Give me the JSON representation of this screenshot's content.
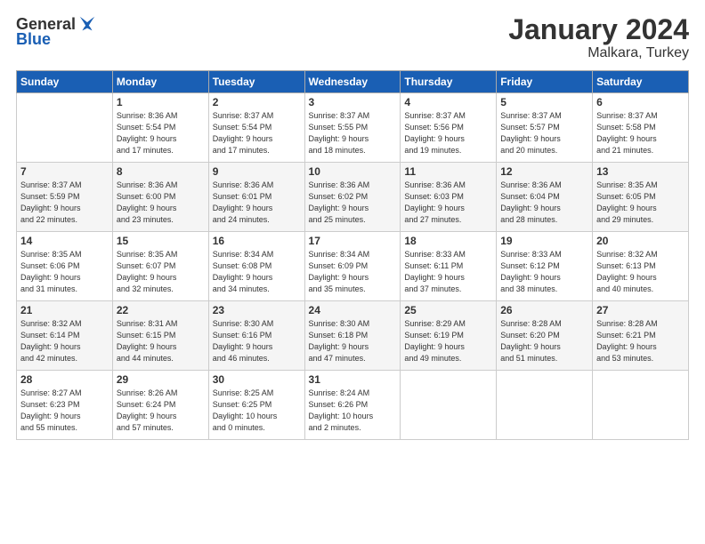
{
  "header": {
    "logo_general": "General",
    "logo_blue": "Blue",
    "month": "January 2024",
    "location": "Malkara, Turkey"
  },
  "weekdays": [
    "Sunday",
    "Monday",
    "Tuesday",
    "Wednesday",
    "Thursday",
    "Friday",
    "Saturday"
  ],
  "weeks": [
    [
      {
        "day": "",
        "content": ""
      },
      {
        "day": "1",
        "content": "Sunrise: 8:36 AM\nSunset: 5:54 PM\nDaylight: 9 hours\nand 17 minutes."
      },
      {
        "day": "2",
        "content": "Sunrise: 8:37 AM\nSunset: 5:54 PM\nDaylight: 9 hours\nand 17 minutes."
      },
      {
        "day": "3",
        "content": "Sunrise: 8:37 AM\nSunset: 5:55 PM\nDaylight: 9 hours\nand 18 minutes."
      },
      {
        "day": "4",
        "content": "Sunrise: 8:37 AM\nSunset: 5:56 PM\nDaylight: 9 hours\nand 19 minutes."
      },
      {
        "day": "5",
        "content": "Sunrise: 8:37 AM\nSunset: 5:57 PM\nDaylight: 9 hours\nand 20 minutes."
      },
      {
        "day": "6",
        "content": "Sunrise: 8:37 AM\nSunset: 5:58 PM\nDaylight: 9 hours\nand 21 minutes."
      }
    ],
    [
      {
        "day": "7",
        "content": "Sunrise: 8:37 AM\nSunset: 5:59 PM\nDaylight: 9 hours\nand 22 minutes."
      },
      {
        "day": "8",
        "content": "Sunrise: 8:36 AM\nSunset: 6:00 PM\nDaylight: 9 hours\nand 23 minutes."
      },
      {
        "day": "9",
        "content": "Sunrise: 8:36 AM\nSunset: 6:01 PM\nDaylight: 9 hours\nand 24 minutes."
      },
      {
        "day": "10",
        "content": "Sunrise: 8:36 AM\nSunset: 6:02 PM\nDaylight: 9 hours\nand 25 minutes."
      },
      {
        "day": "11",
        "content": "Sunrise: 8:36 AM\nSunset: 6:03 PM\nDaylight: 9 hours\nand 27 minutes."
      },
      {
        "day": "12",
        "content": "Sunrise: 8:36 AM\nSunset: 6:04 PM\nDaylight: 9 hours\nand 28 minutes."
      },
      {
        "day": "13",
        "content": "Sunrise: 8:35 AM\nSunset: 6:05 PM\nDaylight: 9 hours\nand 29 minutes."
      }
    ],
    [
      {
        "day": "14",
        "content": "Sunrise: 8:35 AM\nSunset: 6:06 PM\nDaylight: 9 hours\nand 31 minutes."
      },
      {
        "day": "15",
        "content": "Sunrise: 8:35 AM\nSunset: 6:07 PM\nDaylight: 9 hours\nand 32 minutes."
      },
      {
        "day": "16",
        "content": "Sunrise: 8:34 AM\nSunset: 6:08 PM\nDaylight: 9 hours\nand 34 minutes."
      },
      {
        "day": "17",
        "content": "Sunrise: 8:34 AM\nSunset: 6:09 PM\nDaylight: 9 hours\nand 35 minutes."
      },
      {
        "day": "18",
        "content": "Sunrise: 8:33 AM\nSunset: 6:11 PM\nDaylight: 9 hours\nand 37 minutes."
      },
      {
        "day": "19",
        "content": "Sunrise: 8:33 AM\nSunset: 6:12 PM\nDaylight: 9 hours\nand 38 minutes."
      },
      {
        "day": "20",
        "content": "Sunrise: 8:32 AM\nSunset: 6:13 PM\nDaylight: 9 hours\nand 40 minutes."
      }
    ],
    [
      {
        "day": "21",
        "content": "Sunrise: 8:32 AM\nSunset: 6:14 PM\nDaylight: 9 hours\nand 42 minutes."
      },
      {
        "day": "22",
        "content": "Sunrise: 8:31 AM\nSunset: 6:15 PM\nDaylight: 9 hours\nand 44 minutes."
      },
      {
        "day": "23",
        "content": "Sunrise: 8:30 AM\nSunset: 6:16 PM\nDaylight: 9 hours\nand 46 minutes."
      },
      {
        "day": "24",
        "content": "Sunrise: 8:30 AM\nSunset: 6:18 PM\nDaylight: 9 hours\nand 47 minutes."
      },
      {
        "day": "25",
        "content": "Sunrise: 8:29 AM\nSunset: 6:19 PM\nDaylight: 9 hours\nand 49 minutes."
      },
      {
        "day": "26",
        "content": "Sunrise: 8:28 AM\nSunset: 6:20 PM\nDaylight: 9 hours\nand 51 minutes."
      },
      {
        "day": "27",
        "content": "Sunrise: 8:28 AM\nSunset: 6:21 PM\nDaylight: 9 hours\nand 53 minutes."
      }
    ],
    [
      {
        "day": "28",
        "content": "Sunrise: 8:27 AM\nSunset: 6:23 PM\nDaylight: 9 hours\nand 55 minutes."
      },
      {
        "day": "29",
        "content": "Sunrise: 8:26 AM\nSunset: 6:24 PM\nDaylight: 9 hours\nand 57 minutes."
      },
      {
        "day": "30",
        "content": "Sunrise: 8:25 AM\nSunset: 6:25 PM\nDaylight: 10 hours\nand 0 minutes."
      },
      {
        "day": "31",
        "content": "Sunrise: 8:24 AM\nSunset: 6:26 PM\nDaylight: 10 hours\nand 2 minutes."
      },
      {
        "day": "",
        "content": ""
      },
      {
        "day": "",
        "content": ""
      },
      {
        "day": "",
        "content": ""
      }
    ]
  ]
}
